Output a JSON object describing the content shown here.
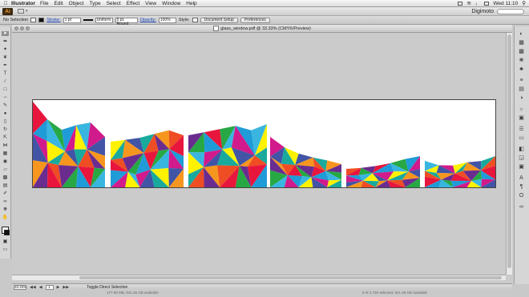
{
  "menubar": {
    "app_name": "Illustrator",
    "items": [
      "File",
      "Edit",
      "Object",
      "Type",
      "Select",
      "Effect",
      "View",
      "Window",
      "Help"
    ],
    "user": "Digimoto",
    "clock": "Wed 11:10"
  },
  "appbar": {
    "logo": "Ai"
  },
  "control_bar": {
    "selection_label": "No Selection",
    "stroke_label": "Stroke:",
    "stroke_weight": "1 pt",
    "profile": "Uniform",
    "brush": "5 pt. Round",
    "opacity_label": "Opacity:",
    "opacity_value": "100%",
    "style_label": "Style:",
    "doc_setup_button": "Document Setup",
    "preferences_button": "Preferences"
  },
  "document": {
    "title": "glass_window.pdf @ 33.33% (CMYK/Preview)",
    "artwork_colors": [
      "#e8163c",
      "#f7961e",
      "#fff200",
      "#1f9bd7",
      "#6a2d8f",
      "#19a99d",
      "#d11a8b",
      "#27a844",
      "#ef4d23",
      "#4154a5",
      "#39b6e0"
    ]
  },
  "status_bar": {
    "zoom": "33.33%",
    "page": "1",
    "tool_hint": "Toggle Direct Selection"
  },
  "bottom_info": {
    "left": "177.99 MB, 941.46 GB available",
    "right": "9 of 1,726 selected, 941.46 GB available"
  },
  "icons": {
    "selection_tool": "selection-arrow-icon",
    "fill_swatch": "fill-swatch-icon",
    "stroke_swatch": "stroke-swatch-icon"
  }
}
